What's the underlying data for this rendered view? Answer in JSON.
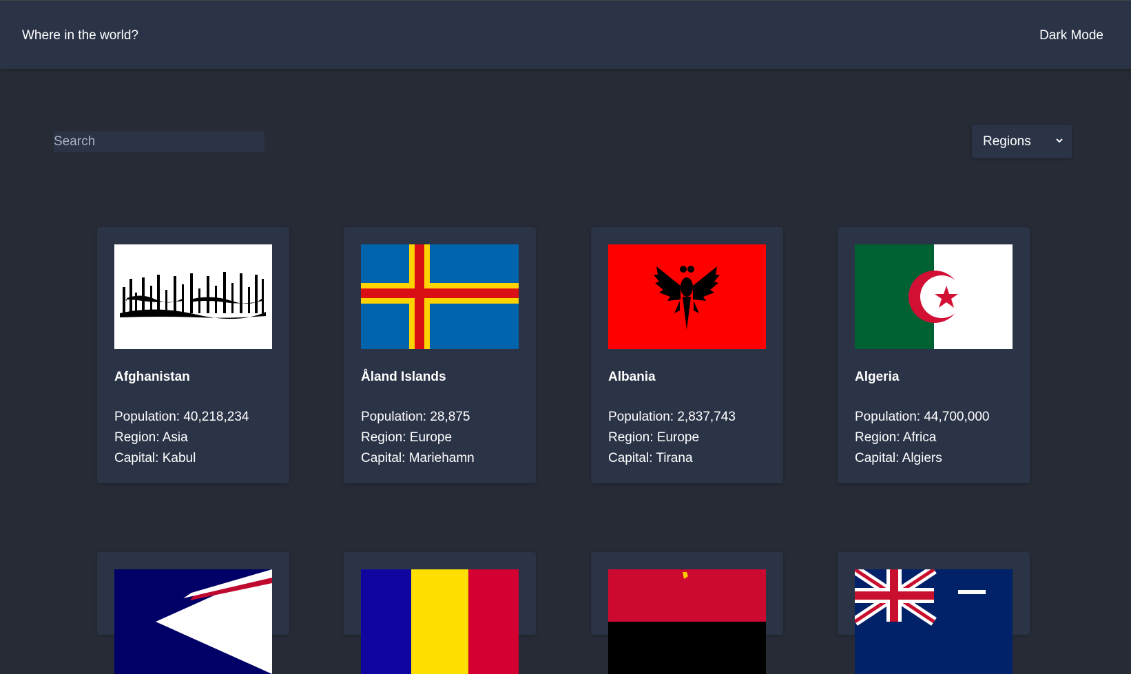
{
  "header": {
    "title": "Where in the world?",
    "mode_label": "Dark Mode"
  },
  "search": {
    "placeholder": "Search",
    "value": ""
  },
  "filter": {
    "label": "Regions"
  },
  "labels": {
    "population": "Population:",
    "region": "Region:",
    "capital": "Capital:"
  },
  "countries": [
    {
      "name": "Afghanistan",
      "population": "40,218,234",
      "region": "Asia",
      "capital": "Kabul",
      "flag": "afghanistan-flag"
    },
    {
      "name": "Åland Islands",
      "population": "28,875",
      "region": "Europe",
      "capital": "Mariehamn",
      "flag": "aland-flag"
    },
    {
      "name": "Albania",
      "population": "2,837,743",
      "region": "Europe",
      "capital": "Tirana",
      "flag": "albania-flag"
    },
    {
      "name": "Algeria",
      "population": "44,700,000",
      "region": "Africa",
      "capital": "Algiers",
      "flag": "algeria-flag"
    },
    {
      "flag": "american-samoa-flag"
    },
    {
      "flag": "andorra-flag"
    },
    {
      "flag": "angola-flag"
    },
    {
      "flag": "anguilla-flag"
    }
  ],
  "colors": {
    "background": "#262b35",
    "surface": "#2b3447",
    "text": "#ffffff"
  }
}
